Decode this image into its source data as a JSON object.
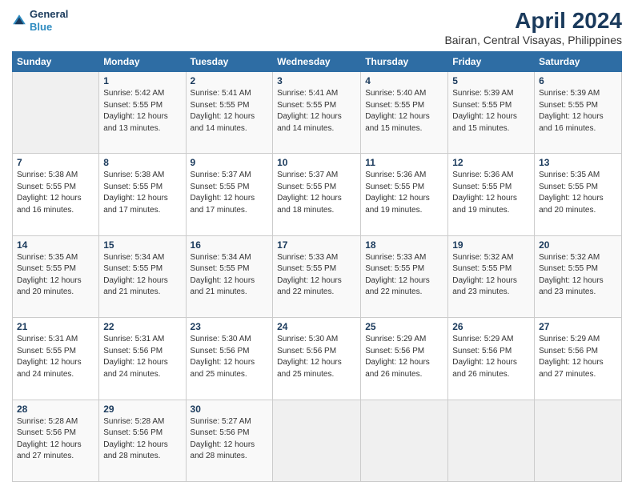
{
  "logo": {
    "line1": "General",
    "line2": "Blue"
  },
  "title": "April 2024",
  "subtitle": "Bairan, Central Visayas, Philippines",
  "weekdays": [
    "Sunday",
    "Monday",
    "Tuesday",
    "Wednesday",
    "Thursday",
    "Friday",
    "Saturday"
  ],
  "weeks": [
    [
      {
        "day": "",
        "info": ""
      },
      {
        "day": "1",
        "info": "Sunrise: 5:42 AM\nSunset: 5:55 PM\nDaylight: 12 hours\nand 13 minutes."
      },
      {
        "day": "2",
        "info": "Sunrise: 5:41 AM\nSunset: 5:55 PM\nDaylight: 12 hours\nand 14 minutes."
      },
      {
        "day": "3",
        "info": "Sunrise: 5:41 AM\nSunset: 5:55 PM\nDaylight: 12 hours\nand 14 minutes."
      },
      {
        "day": "4",
        "info": "Sunrise: 5:40 AM\nSunset: 5:55 PM\nDaylight: 12 hours\nand 15 minutes."
      },
      {
        "day": "5",
        "info": "Sunrise: 5:39 AM\nSunset: 5:55 PM\nDaylight: 12 hours\nand 15 minutes."
      },
      {
        "day": "6",
        "info": "Sunrise: 5:39 AM\nSunset: 5:55 PM\nDaylight: 12 hours\nand 16 minutes."
      }
    ],
    [
      {
        "day": "7",
        "info": "Sunrise: 5:38 AM\nSunset: 5:55 PM\nDaylight: 12 hours\nand 16 minutes."
      },
      {
        "day": "8",
        "info": "Sunrise: 5:38 AM\nSunset: 5:55 PM\nDaylight: 12 hours\nand 17 minutes."
      },
      {
        "day": "9",
        "info": "Sunrise: 5:37 AM\nSunset: 5:55 PM\nDaylight: 12 hours\nand 17 minutes."
      },
      {
        "day": "10",
        "info": "Sunrise: 5:37 AM\nSunset: 5:55 PM\nDaylight: 12 hours\nand 18 minutes."
      },
      {
        "day": "11",
        "info": "Sunrise: 5:36 AM\nSunset: 5:55 PM\nDaylight: 12 hours\nand 19 minutes."
      },
      {
        "day": "12",
        "info": "Sunrise: 5:36 AM\nSunset: 5:55 PM\nDaylight: 12 hours\nand 19 minutes."
      },
      {
        "day": "13",
        "info": "Sunrise: 5:35 AM\nSunset: 5:55 PM\nDaylight: 12 hours\nand 20 minutes."
      }
    ],
    [
      {
        "day": "14",
        "info": "Sunrise: 5:35 AM\nSunset: 5:55 PM\nDaylight: 12 hours\nand 20 minutes."
      },
      {
        "day": "15",
        "info": "Sunrise: 5:34 AM\nSunset: 5:55 PM\nDaylight: 12 hours\nand 21 minutes."
      },
      {
        "day": "16",
        "info": "Sunrise: 5:34 AM\nSunset: 5:55 PM\nDaylight: 12 hours\nand 21 minutes."
      },
      {
        "day": "17",
        "info": "Sunrise: 5:33 AM\nSunset: 5:55 PM\nDaylight: 12 hours\nand 22 minutes."
      },
      {
        "day": "18",
        "info": "Sunrise: 5:33 AM\nSunset: 5:55 PM\nDaylight: 12 hours\nand 22 minutes."
      },
      {
        "day": "19",
        "info": "Sunrise: 5:32 AM\nSunset: 5:55 PM\nDaylight: 12 hours\nand 23 minutes."
      },
      {
        "day": "20",
        "info": "Sunrise: 5:32 AM\nSunset: 5:55 PM\nDaylight: 12 hours\nand 23 minutes."
      }
    ],
    [
      {
        "day": "21",
        "info": "Sunrise: 5:31 AM\nSunset: 5:55 PM\nDaylight: 12 hours\nand 24 minutes."
      },
      {
        "day": "22",
        "info": "Sunrise: 5:31 AM\nSunset: 5:56 PM\nDaylight: 12 hours\nand 24 minutes."
      },
      {
        "day": "23",
        "info": "Sunrise: 5:30 AM\nSunset: 5:56 PM\nDaylight: 12 hours\nand 25 minutes."
      },
      {
        "day": "24",
        "info": "Sunrise: 5:30 AM\nSunset: 5:56 PM\nDaylight: 12 hours\nand 25 minutes."
      },
      {
        "day": "25",
        "info": "Sunrise: 5:29 AM\nSunset: 5:56 PM\nDaylight: 12 hours\nand 26 minutes."
      },
      {
        "day": "26",
        "info": "Sunrise: 5:29 AM\nSunset: 5:56 PM\nDaylight: 12 hours\nand 26 minutes."
      },
      {
        "day": "27",
        "info": "Sunrise: 5:29 AM\nSunset: 5:56 PM\nDaylight: 12 hours\nand 27 minutes."
      }
    ],
    [
      {
        "day": "28",
        "info": "Sunrise: 5:28 AM\nSunset: 5:56 PM\nDaylight: 12 hours\nand 27 minutes."
      },
      {
        "day": "29",
        "info": "Sunrise: 5:28 AM\nSunset: 5:56 PM\nDaylight: 12 hours\nand 28 minutes."
      },
      {
        "day": "30",
        "info": "Sunrise: 5:27 AM\nSunset: 5:56 PM\nDaylight: 12 hours\nand 28 minutes."
      },
      {
        "day": "",
        "info": ""
      },
      {
        "day": "",
        "info": ""
      },
      {
        "day": "",
        "info": ""
      },
      {
        "day": "",
        "info": ""
      }
    ]
  ]
}
